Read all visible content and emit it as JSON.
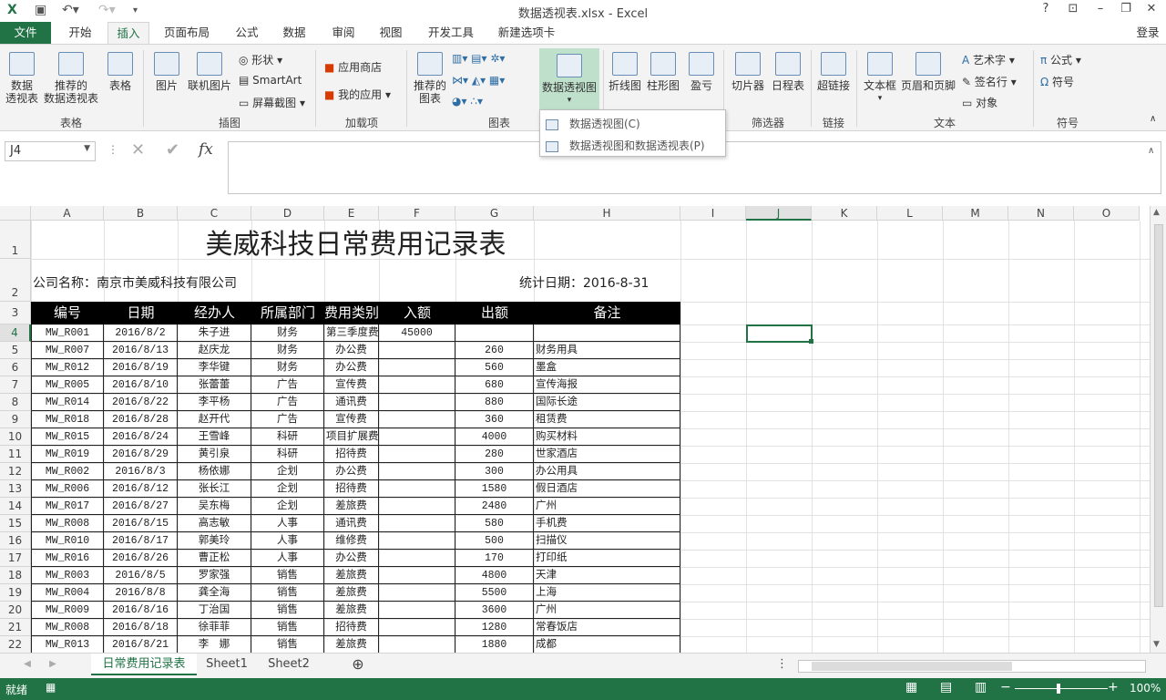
{
  "window": {
    "title": "数据透视表.xlsx - Excel",
    "help": "?",
    "signin": "登录"
  },
  "tabs": [
    "文件",
    "开始",
    "插入",
    "页面布局",
    "公式",
    "数据",
    "审阅",
    "视图",
    "开发工具",
    "新建选项卡"
  ],
  "ribbon": {
    "groups": [
      "表格",
      "插图",
      "加载项",
      "图表",
      "筛选器",
      "链接",
      "文本",
      "符号"
    ],
    "table": {
      "pivot": "数据\n透视表",
      "recommended_pivot": "推荐的\n数据透视表",
      "table": "表格"
    },
    "illustrations": {
      "pictures": "图片",
      "online_pictures": "联机图片",
      "shapes": "形状",
      "smartart": "SmartArt",
      "screenshot": "屏幕截图"
    },
    "addins": {
      "store": "应用商店",
      "my_apps": "我的应用"
    },
    "charts": {
      "recommended": "推荐的\n图表",
      "pivot_chart": "数据透视图"
    },
    "sparklines": {
      "line": "折线图",
      "column": "柱形图",
      "winloss": "盈亏"
    },
    "filters": {
      "slicer": "切片器",
      "timeline": "日程表"
    },
    "links": {
      "hyperlink": "超链接"
    },
    "text": {
      "textbox": "文本框",
      "header_footer": "页眉和页脚",
      "wordart": "艺术字",
      "signature": "签名行",
      "object": "对象"
    },
    "symbols": {
      "equation": "公式",
      "symbol": "符号"
    }
  },
  "pivot_dropdown": {
    "item1": "数据透视图(C)",
    "item2": "数据透视图和数据透视表(P)"
  },
  "formula_bar": {
    "name_box": "J4",
    "fx": "fx"
  },
  "columns": [
    "A",
    "B",
    "C",
    "D",
    "E",
    "F",
    "G",
    "H",
    "I",
    "J",
    "K",
    "L",
    "M",
    "N",
    "O"
  ],
  "sheet": {
    "title": "美威科技日常费用记录表",
    "company": "公司名称：南京市美威科技有限公司",
    "date": "统计日期：2016-8-31",
    "headers": [
      "编号",
      "日期",
      "经办人",
      "所属部门",
      "费用类别",
      "入额",
      "出额",
      "备注"
    ],
    "rows": [
      [
        "MW_R001",
        "2016/8/2",
        "朱子进",
        "财务",
        "第三季度费用",
        "45000",
        "",
        ""
      ],
      [
        "MW_R007",
        "2016/8/13",
        "赵庆龙",
        "财务",
        "办公费",
        "",
        "260",
        "财务用具"
      ],
      [
        "MW_R012",
        "2016/8/19",
        "李华键",
        "财务",
        "办公费",
        "",
        "560",
        "墨盒"
      ],
      [
        "MW_R005",
        "2016/8/10",
        "张蕾蕾",
        "广告",
        "宣传费",
        "",
        "680",
        "宣传海报"
      ],
      [
        "MW_R014",
        "2016/8/22",
        "李平杨",
        "广告",
        "通讯费",
        "",
        "880",
        "国际长途"
      ],
      [
        "MW_R018",
        "2016/8/28",
        "赵开代",
        "广告",
        "宣传费",
        "",
        "360",
        "租赁费"
      ],
      [
        "MW_R015",
        "2016/8/24",
        "王雪峰",
        "科研",
        "项目扩展费",
        "",
        "4000",
        "购买材料"
      ],
      [
        "MW_R019",
        "2016/8/29",
        "黄引泉",
        "科研",
        "招待费",
        "",
        "280",
        "世家酒店"
      ],
      [
        "MW_R002",
        "2016/8/3",
        "杨依娜",
        "企划",
        "办公费",
        "",
        "300",
        "办公用具"
      ],
      [
        "MW_R006",
        "2016/8/12",
        "张长江",
        "企划",
        "招待费",
        "",
        "1580",
        "假日酒店"
      ],
      [
        "MW_R017",
        "2016/8/27",
        "吴东梅",
        "企划",
        "差旅费",
        "",
        "2480",
        "广州"
      ],
      [
        "MW_R008",
        "2016/8/15",
        "高志敏",
        "人事",
        "通讯费",
        "",
        "580",
        "手机费"
      ],
      [
        "MW_R010",
        "2016/8/17",
        "郭美玲",
        "人事",
        "维修费",
        "",
        "500",
        "扫描仪"
      ],
      [
        "MW_R016",
        "2016/8/26",
        "曹正松",
        "人事",
        "办公费",
        "",
        "170",
        "打印纸"
      ],
      [
        "MW_R003",
        "2016/8/5",
        "罗家强",
        "销售",
        "差旅费",
        "",
        "4800",
        "天津"
      ],
      [
        "MW_R004",
        "2016/8/8",
        "龚全海",
        "销售",
        "差旅费",
        "",
        "5500",
        "上海"
      ],
      [
        "MW_R009",
        "2016/8/16",
        "丁治国",
        "销售",
        "差旅费",
        "",
        "3600",
        "广州"
      ],
      [
        "MW_R008",
        "2016/8/18",
        "徐菲菲",
        "销售",
        "招待费",
        "",
        "1280",
        "常春饭店"
      ],
      [
        "MW_R013",
        "2016/8/21",
        "李　娜",
        "销售",
        "差旅费",
        "",
        "1880",
        "成都"
      ]
    ]
  },
  "sheet_tabs": [
    "日常费用记录表",
    "Sheet1",
    "Sheet2"
  ],
  "status": {
    "ready": "就绪",
    "zoom": "100%"
  },
  "colors": {
    "accent": "#217346"
  }
}
